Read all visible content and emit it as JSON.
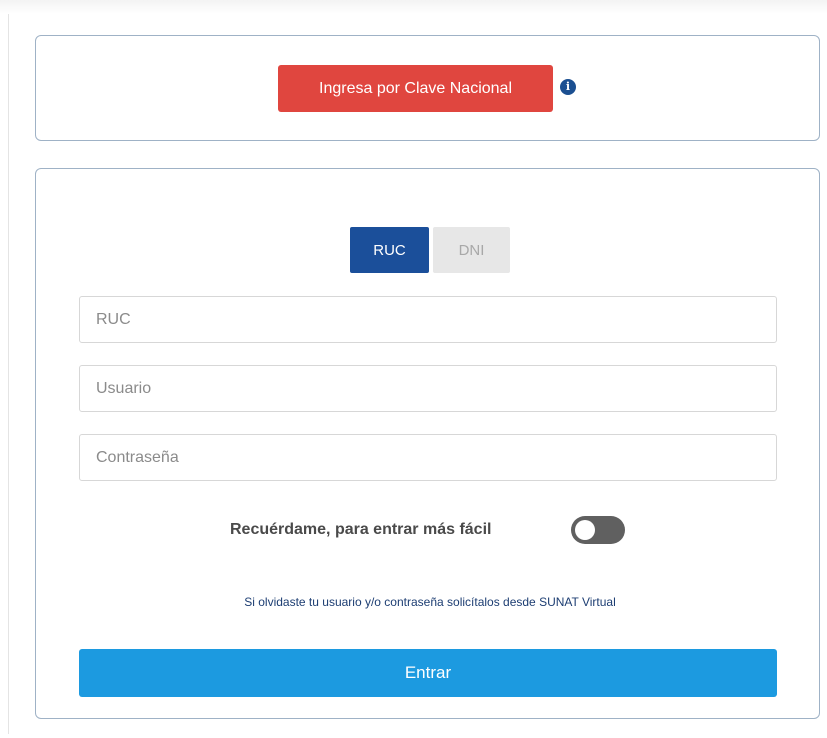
{
  "clave_nacional": {
    "button_label": "Ingresa por Clave Nacional",
    "info_icon": "info-icon",
    "info_glyph": "i"
  },
  "login_type": {
    "tabs": [
      {
        "label": "RUC",
        "selected": true
      },
      {
        "label": "DNI",
        "selected": false
      }
    ]
  },
  "form": {
    "ruc": {
      "placeholder": "RUC",
      "value": ""
    },
    "usuario": {
      "placeholder": "Usuario",
      "value": ""
    },
    "password": {
      "placeholder": "Contraseña",
      "value": ""
    }
  },
  "remember": {
    "label": "Recuérdame, para entrar más fácil",
    "checked": false
  },
  "forgot": {
    "text": "Si olvidaste tu usuario y/o contraseña solicítalos desde SUNAT Virtual"
  },
  "submit": {
    "label": "Entrar"
  },
  "colors": {
    "clave_button": "#e0463f",
    "tab_active": "#1b4f9a",
    "tab_inactive": "#e7e7e7",
    "submit_button": "#1c9ae0",
    "toggle_off": "#606060",
    "panel_border": "#9fb2c6"
  }
}
